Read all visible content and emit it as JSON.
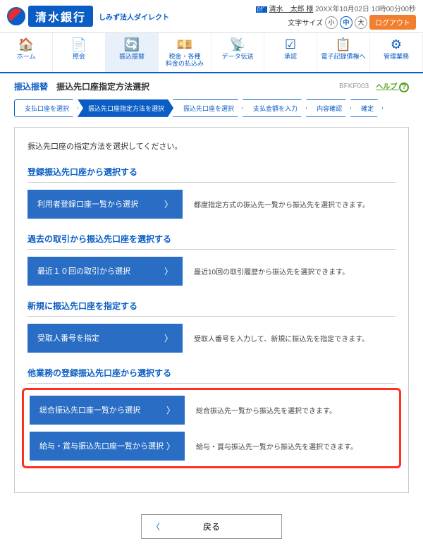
{
  "header": {
    "bank_name": "清水銀行",
    "subtitle": "しみず法人ダイレクト",
    "user_badge": "ﾛｸﾞ",
    "user_name": "清水　太郎 様",
    "timestamp": "20XX年10月02日 10時00分00秒",
    "font_label": "文字サイズ",
    "size_s": "小",
    "size_m": "中",
    "size_l": "大",
    "logout": "ログアウト"
  },
  "nav": {
    "items": [
      {
        "icon": "🏠",
        "label": "ホーム"
      },
      {
        "icon": "📄",
        "label": "照会"
      },
      {
        "icon": "🔄",
        "label": "振込振替"
      },
      {
        "icon": "💴",
        "label": "税金・各種\n料金の払込み"
      },
      {
        "icon": "📡",
        "label": "データ伝送"
      },
      {
        "icon": "☑",
        "label": "承認"
      },
      {
        "icon": "📋",
        "label": "電子記録債権へ"
      },
      {
        "icon": "⚙",
        "label": "管理業務"
      }
    ]
  },
  "breadcrumb": {
    "category": "振込振替",
    "title": "振込先口座指定方法選択",
    "screen_id": "BFKF003",
    "help": "ヘルプ"
  },
  "steps": [
    "支払口座を選択",
    "振込先口座指定方法を選択",
    "振込先口座を選択",
    "支払金額を入力",
    "内容確認",
    "確定"
  ],
  "intro": "振込先口座の指定方法を選択してください。",
  "sections": [
    {
      "head": "登録振込先口座から選択する",
      "rows": [
        {
          "btn": "利用者登録口座一覧から選択",
          "desc": "都度指定方式の振込先一覧から振込先を選択できます。"
        }
      ]
    },
    {
      "head": "過去の取引から振込先口座を選択する",
      "rows": [
        {
          "btn": "最近１０回の取引から選択",
          "desc": "最近10回の取引履歴から振込先を選択できます。"
        }
      ]
    },
    {
      "head": "新規に振込先口座を指定する",
      "rows": [
        {
          "btn": "受取人番号を指定",
          "desc": "受取人番号を入力して、新規に振込先を指定できます。"
        }
      ]
    },
    {
      "head": "他業務の登録振込先口座から選択する",
      "highlight": true,
      "rows": [
        {
          "btn": "総合振込先口座一覧から選択",
          "desc": "総合振込先一覧から振込先を選択できます。"
        },
        {
          "btn": "給与・賞与振込先口座一覧から選択",
          "desc": "給与・賞与振込先一覧から振込先を選択できます。"
        }
      ]
    }
  ],
  "back": "戻る"
}
